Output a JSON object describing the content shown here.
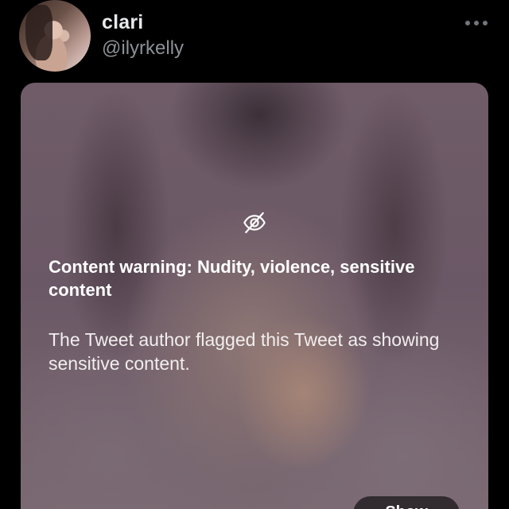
{
  "author": {
    "display_name": "clari",
    "handle": "@ilyrkelly"
  },
  "header": {
    "more_icon": "more-horizontal-icon"
  },
  "sensitive_media": {
    "icon": "eye-slash-icon",
    "title": "Content warning: Nudity, violence, sensitive content",
    "body": "The Tweet author flagged this Tweet as showing sensitive content.",
    "show_button_label": "Show"
  },
  "colors": {
    "background": "#000000",
    "display_name": "#e7e9ea",
    "handle": "#8b9197",
    "warning_text": "#ffffff"
  }
}
